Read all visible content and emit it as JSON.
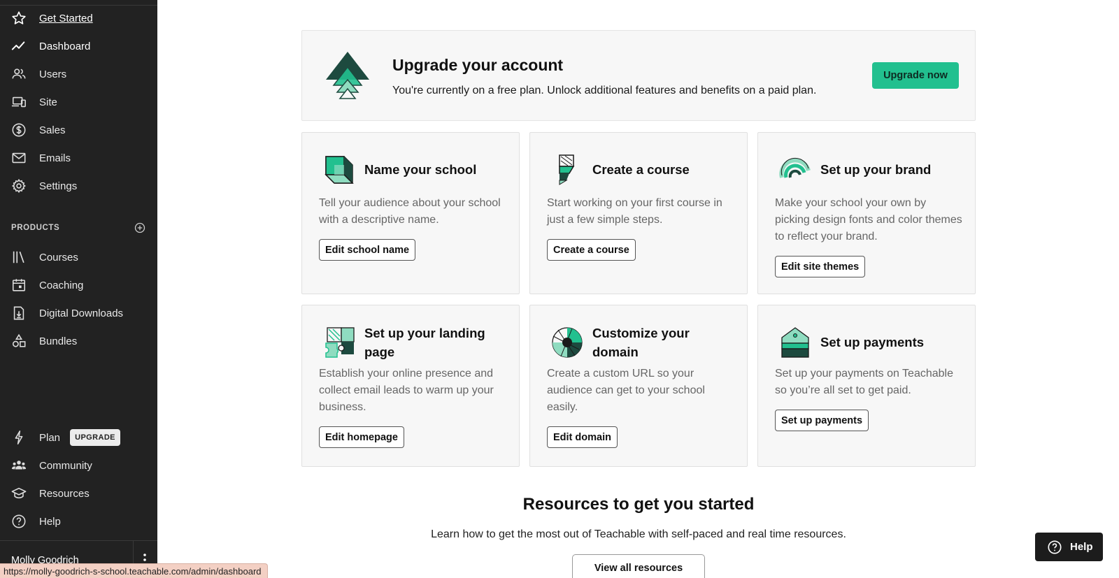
{
  "sidebar": {
    "nav": [
      {
        "label": "Get Started",
        "icon": "star-icon"
      },
      {
        "label": "Dashboard",
        "icon": "trend-line-icon"
      },
      {
        "label": "Users",
        "icon": "users-icon"
      },
      {
        "label": "Site",
        "icon": "devices-icon"
      },
      {
        "label": "Sales",
        "icon": "dollar-icon"
      },
      {
        "label": "Emails",
        "icon": "mail-icon"
      },
      {
        "label": "Settings",
        "icon": "gear-icon"
      }
    ],
    "products_header": "PRODUCTS",
    "products": [
      {
        "label": "Courses",
        "icon": "library-icon"
      },
      {
        "label": "Coaching",
        "icon": "calendar-icon"
      },
      {
        "label": "Digital Downloads",
        "icon": "download-file-icon"
      },
      {
        "label": "Bundles",
        "icon": "shapes-icon"
      }
    ],
    "bottom": [
      {
        "label": "Plan",
        "icon": "lightning-icon"
      },
      {
        "label": "Community",
        "icon": "community-icon"
      },
      {
        "label": "Resources",
        "icon": "graduation-cap-icon"
      },
      {
        "label": "Help",
        "icon": "help-circle-icon"
      }
    ],
    "upgrade_badge": "UPGRADE",
    "user_name": "Molly Goodrich"
  },
  "status_url": "https://molly-goodrich-s-school.teachable.com/admin/dashboard",
  "banner": {
    "title": "Upgrade your account",
    "subtitle": "You're currently on a free plan. Unlock additional features and benefits on a paid plan.",
    "button": "Upgrade now"
  },
  "cards": [
    {
      "title": "Name your school",
      "desc": "Tell your audience about your school with a descriptive name.",
      "button": "Edit school name"
    },
    {
      "title": "Create a course",
      "desc": "Start working on your first course in just a few simple steps.",
      "button": "Create a course"
    },
    {
      "title": "Set up your brand",
      "desc": "Make your school your own by picking design fonts and color themes to reflect your brand.",
      "button": "Edit site themes"
    },
    {
      "title": "Set up your landing page",
      "desc": "Establish your online presence and collect email leads to warm up your business.",
      "button": "Edit homepage"
    },
    {
      "title": "Customize your domain",
      "desc": "Create a custom URL so your audience can get to your school easily.",
      "button": "Edit domain"
    },
    {
      "title": "Set up payments",
      "desc": "Set up your payments on Teachable so you’re all set to get paid.",
      "button": "Set up payments"
    }
  ],
  "resources": {
    "title": "Resources to get you started",
    "subtitle": "Learn how to get the most out of Teachable with self-paced and real time resources.",
    "button": "View all resources"
  },
  "help_button": "Help",
  "colors": {
    "accent": "#22c08f",
    "sidebar_bg": "#222222",
    "card_bg": "#f7f7f7"
  }
}
